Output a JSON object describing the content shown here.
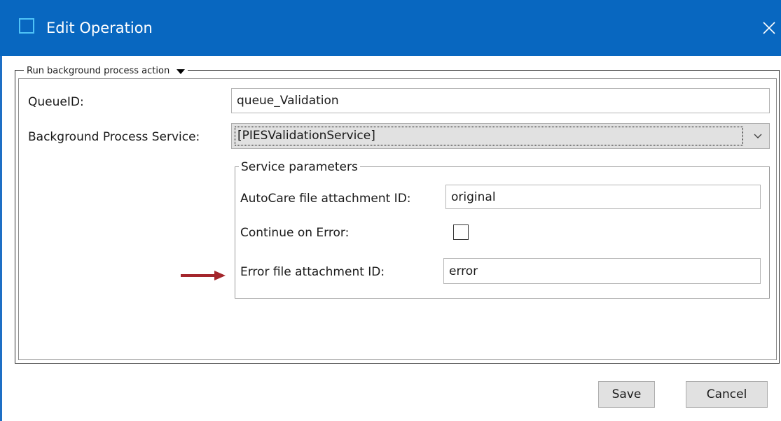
{
  "window": {
    "title": "Edit Operation",
    "title_bar_color": "#0867c0",
    "icons": {
      "app": "window-icon",
      "close": "close-icon"
    }
  },
  "action_group": {
    "legend": "Run background process action",
    "legend_icon": "dropdown-triangle-icon"
  },
  "fields": {
    "queue_id": {
      "label": "QueueID:",
      "value": "queue_Validation"
    },
    "background_service": {
      "label": "Background Process Service:",
      "selected": "[PIESValidationService]"
    }
  },
  "service_parameters": {
    "legend": "Service parameters",
    "autocare_attachment": {
      "label": "AutoCare file attachment ID:",
      "value": "original"
    },
    "continue_on_error": {
      "label": "Continue on Error:",
      "checked": false
    },
    "error_attachment": {
      "label": "Error file attachment ID:",
      "value": "error"
    }
  },
  "annotation": {
    "icon": "right-arrow-icon",
    "color": "#a4262c"
  },
  "buttons": {
    "save": "Save",
    "cancel": "Cancel"
  }
}
